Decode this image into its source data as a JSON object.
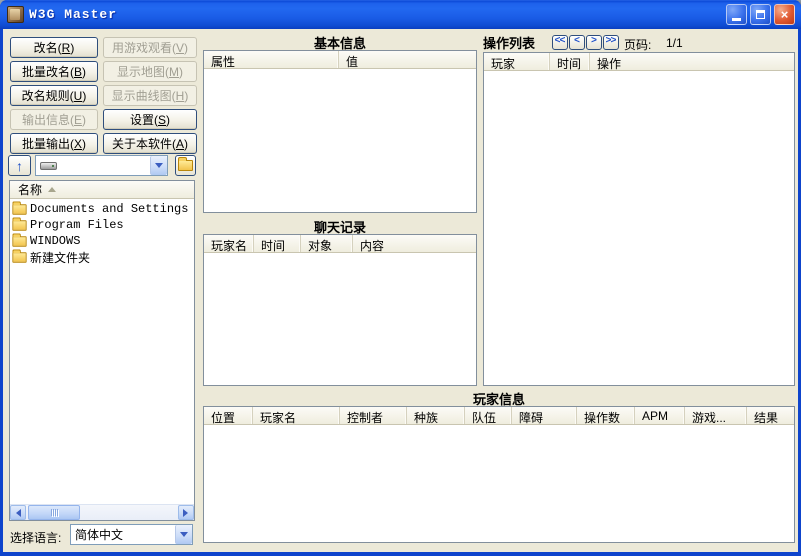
{
  "window": {
    "title": "W3G Master"
  },
  "icons": {
    "app": "w3g-scroll-icon",
    "minimize": "minimize-icon",
    "maximize": "maximize-icon",
    "close": "close-icon",
    "up": "up-directory-icon",
    "drive": "hard-drive-icon",
    "open_folder": "open-folder-icon",
    "folder": "folder-icon",
    "sort": "sort-ascending-icon"
  },
  "left": {
    "buttons": [
      {
        "pre": "改名(",
        "key": "R",
        "suf": ")",
        "enabled": true
      },
      {
        "pre": "用游戏观看(",
        "key": "V",
        "suf": ")",
        "enabled": false
      },
      {
        "pre": "批量改名(",
        "key": "B",
        "suf": ")",
        "enabled": true
      },
      {
        "pre": "显示地图(",
        "key": "M",
        "suf": ")",
        "enabled": false
      },
      {
        "pre": "改名规则(",
        "key": "U",
        "suf": ")",
        "enabled": true
      },
      {
        "pre": "显示曲线图(",
        "key": "H",
        "suf": ")",
        "enabled": false
      },
      {
        "pre": "输出信息(",
        "key": "E",
        "suf": ")",
        "enabled": false
      },
      {
        "pre": "设置(",
        "key": "S",
        "suf": ")",
        "enabled": true
      },
      {
        "pre": "批量输出(",
        "key": "X",
        "suf": ")",
        "enabled": true
      },
      {
        "pre": "关于本软件(",
        "key": "A",
        "suf": ")",
        "enabled": true
      }
    ],
    "file_list": {
      "header": "名称",
      "items": [
        "Documents and Settings",
        "Program Files",
        "WINDOWS",
        "新建文件夹"
      ]
    },
    "language": {
      "label": "选择语言:",
      "value": "简体中文"
    }
  },
  "basic_info": {
    "title": "基本信息",
    "columns": [
      "属性",
      "值"
    ]
  },
  "chat": {
    "title": "聊天记录",
    "columns": [
      "玩家名",
      "时间",
      "对象",
      "内容"
    ]
  },
  "actions": {
    "title": "操作列表",
    "pager": [
      "<<",
      "<",
      ">",
      ">>"
    ],
    "page_label": "页码:",
    "page_value": "1/1",
    "columns": [
      "玩家",
      "时间",
      "操作"
    ]
  },
  "players": {
    "title": "玩家信息",
    "columns": [
      "位置",
      "玩家名",
      "控制者",
      "种族",
      "队伍",
      "障碍",
      "操作数",
      "APM",
      "游戏...",
      "结果"
    ]
  },
  "colors": {
    "titlebar_blue": "#1558E0",
    "client_bg": "#ECE9D8",
    "panel_border": "#828F9C",
    "button_border": "#2F4E7C",
    "close_red": "#DC5230",
    "scrollbar_blue": "#C2D6F8",
    "header_face": "#EFEDDE"
  }
}
